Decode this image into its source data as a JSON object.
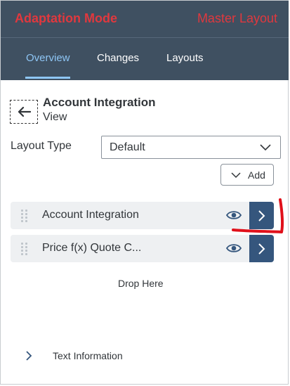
{
  "app": {
    "title": "Adaptation Mode",
    "layout_mode": "Master Layout"
  },
  "tabs": [
    {
      "label": "Overview",
      "active": true
    },
    {
      "label": "Changes",
      "active": false
    },
    {
      "label": "Layouts",
      "active": false
    }
  ],
  "header": {
    "title": "Account Integration",
    "subtitle": "View"
  },
  "layout_type": {
    "label": "Layout Type",
    "value": "Default"
  },
  "add_button": {
    "label": "Add"
  },
  "sections": [
    {
      "name": "Account Integration"
    },
    {
      "name": "Price f(x) Quote C..."
    }
  ],
  "drop_zone": {
    "label": "Drop Here"
  },
  "text_information": {
    "label": "Text Information"
  },
  "icons": {
    "back": "arrow-left-icon",
    "dropdown": "chevron-down-icon",
    "grip": "grip-icon",
    "visibility": "eye-icon",
    "navigate": "chevron-right-icon",
    "expand": "chevron-right-icon"
  },
  "colors": {
    "shell_background": "#3f5061",
    "title_red": "#e0383e",
    "active_tab": "#8ec6f5",
    "nav_button": "#35567d",
    "section_background": "#eef0f2",
    "icon_blue": "#35567d",
    "annotation_red": "#e0101a"
  }
}
